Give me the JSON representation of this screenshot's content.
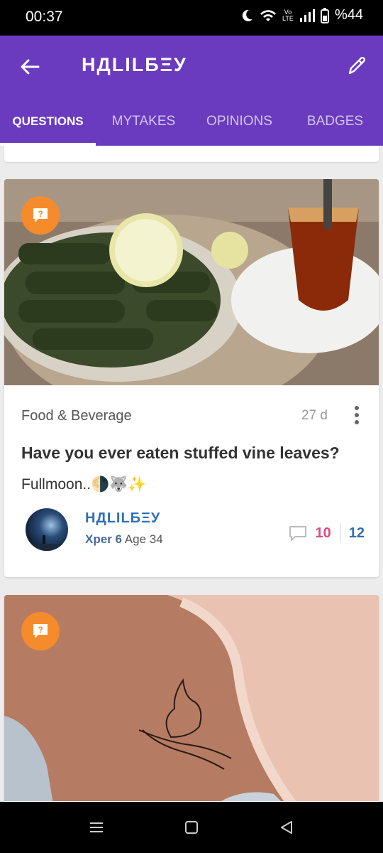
{
  "status": {
    "time": "00:37",
    "battery": "%44",
    "network_badge": "Vo LTE"
  },
  "header": {
    "title": "НДLILБΞУ"
  },
  "tabs": [
    {
      "label": "QUESTIONS",
      "active": true
    },
    {
      "label": "MYTAKES",
      "active": false
    },
    {
      "label": "OPINIONS",
      "active": false
    },
    {
      "label": "BADGES",
      "active": false
    }
  ],
  "post": {
    "category": "Food & Beverage",
    "age": "27 d",
    "title": "Have you ever eaten stuffed vine leaves?",
    "description": "Fullmoon..🌗🐺✨",
    "author": {
      "name": "НДLILБΞУ",
      "level": "Xper 6",
      "age_text": "Age 34"
    },
    "comments": "10",
    "views": "12"
  },
  "colors": {
    "appbar": "#6a3bbf",
    "badge": "#f68b2b",
    "accent_pink": "#e04a7e",
    "accent_blue": "#2f6fb5"
  }
}
